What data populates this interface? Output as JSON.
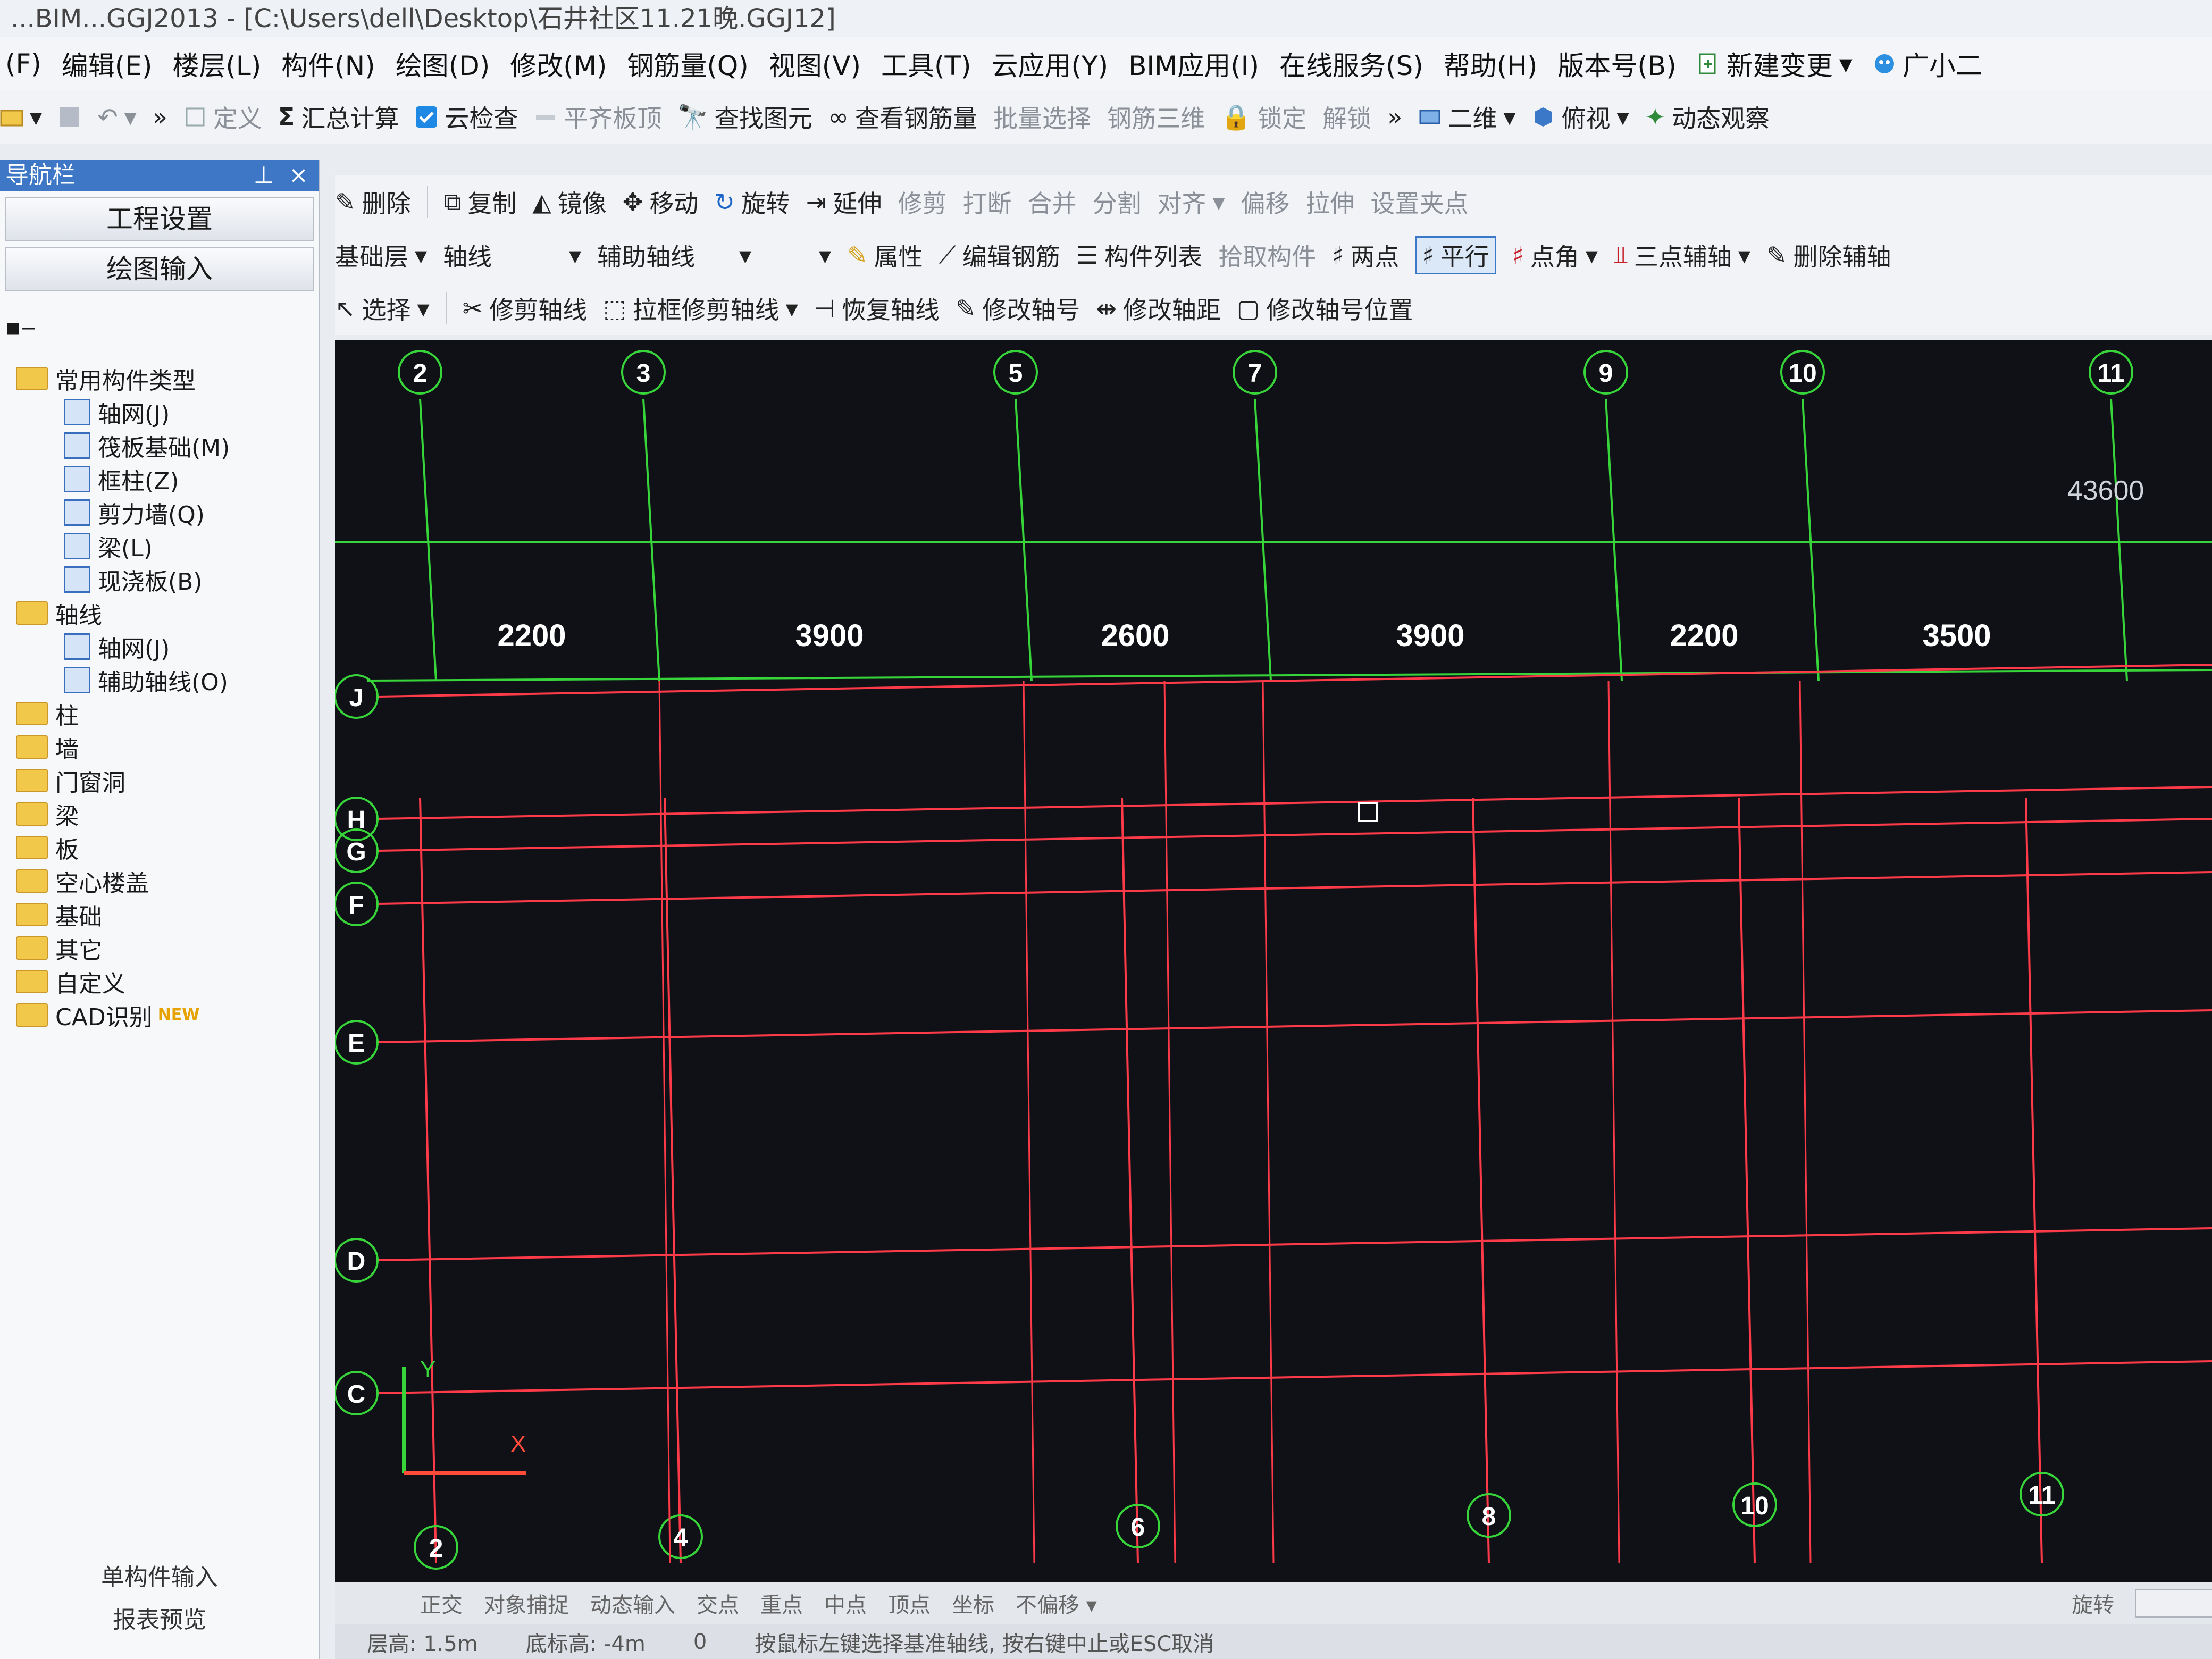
{
  "window": {
    "title": "...BIM...GGJ2013 - [C:\\Users\\dell\\Desktop\\石井社区11.21晚.GGJ12]"
  },
  "menu": [
    "(F)",
    "编辑(E)",
    "楼层(L)",
    "构件(N)",
    "绘图(D)",
    "修改(M)",
    "钢筋量(Q)",
    "视图(V)",
    "工具(T)",
    "云应用(Y)",
    "BIM应用(I)",
    "在线服务(S)",
    "帮助(H)",
    "版本号(B)"
  ],
  "menu_extra": {
    "new_change": "新建变更",
    "assistant": "广小二"
  },
  "toolbar1": {
    "define": "定义",
    "sum_calc": "汇总计算",
    "cloud_check": "云检查",
    "flat_slab_top": "平齐板顶",
    "find_element": "查找图元",
    "view_rebar": "查看钢筋量",
    "batch_select": "批量选择",
    "rebar_3d": "钢筋三维",
    "lock": "锁定",
    "unlock": "解锁",
    "view_2d": "二维",
    "top_view": "俯视",
    "dynamic_view": "动态观察"
  },
  "toolbar2": {
    "delete": "删除",
    "copy": "复制",
    "mirror": "镜像",
    "move": "移动",
    "rotate": "旋转",
    "extend": "延伸",
    "trim": "修剪",
    "break": "打断",
    "merge": "合并",
    "split": "分割",
    "align": "对齐",
    "offset": "偏移",
    "stretch": "拉伸",
    "set_grip": "设置夹点"
  },
  "toolbar3": {
    "floor": "基础层",
    "category": "轴线",
    "subtype": "辅助轴线",
    "property": "属性",
    "edit_rebar": "编辑钢筋",
    "element_list": "构件列表",
    "pick_element": "拾取构件",
    "two_point": "两点",
    "parallel": "平行",
    "point_angle": "点角",
    "three_point_aux": "三点辅轴",
    "delete_aux": "删除辅轴"
  },
  "toolbar4": {
    "select": "选择",
    "trim_axis": "修剪轴线",
    "box_trim_axis": "拉框修剪轴线",
    "restore_axis": "恢复轴线",
    "edit_axis_no": "修改轴号",
    "edit_axis_dist": "修改轴距",
    "edit_axis_pos": "修改轴号位置"
  },
  "nav": {
    "title": "导航栏",
    "project_settings": "工程设置",
    "drawing_input": "绘图输入",
    "tree": [
      {
        "label": "常用构件类型",
        "type": "folder",
        "indent": 0
      },
      {
        "label": "轴网(J)",
        "type": "item",
        "indent": 1
      },
      {
        "label": "筏板基础(M)",
        "type": "item",
        "indent": 1
      },
      {
        "label": "框柱(Z)",
        "type": "item",
        "indent": 1
      },
      {
        "label": "剪力墙(Q)",
        "type": "item",
        "indent": 1
      },
      {
        "label": "梁(L)",
        "type": "item",
        "indent": 1
      },
      {
        "label": "现浇板(B)",
        "type": "item",
        "indent": 1
      },
      {
        "label": "轴线",
        "type": "folder",
        "indent": 0
      },
      {
        "label": "轴网(J)",
        "type": "item",
        "indent": 1
      },
      {
        "label": "辅助轴线(O)",
        "type": "item",
        "indent": 1
      },
      {
        "label": "柱",
        "type": "folder",
        "indent": 0
      },
      {
        "label": "墙",
        "type": "folder",
        "indent": 0
      },
      {
        "label": "门窗洞",
        "type": "folder",
        "indent": 0
      },
      {
        "label": "梁",
        "type": "folder",
        "indent": 0
      },
      {
        "label": "板",
        "type": "folder",
        "indent": 0
      },
      {
        "label": "空心楼盖",
        "type": "folder",
        "indent": 0
      },
      {
        "label": "基础",
        "type": "folder",
        "indent": 0
      },
      {
        "label": "其它",
        "type": "folder",
        "indent": 0
      },
      {
        "label": "自定义",
        "type": "folder",
        "indent": 0
      },
      {
        "label": "CAD识别",
        "type": "folder",
        "indent": 0
      }
    ],
    "new_badge": "NEW",
    "single_input": "单构件输入",
    "report_preview": "报表预览"
  },
  "grid": {
    "top_axes": [
      "2",
      "3",
      "5",
      "7",
      "9",
      "10",
      "11"
    ],
    "bottom_axes": [
      "2",
      "4",
      "6",
      "8",
      "10",
      "11"
    ],
    "left_axes": [
      "J",
      "H",
      "G",
      "F",
      "E",
      "D",
      "C"
    ],
    "spacings": [
      "2200",
      "3900",
      "2600",
      "3900",
      "2200",
      "3500"
    ],
    "total": "43600",
    "colors": {
      "background": "#0f1116",
      "main_axis": "#37d43a",
      "aux_axis": "#ff3b4a",
      "label": "#ffffff"
    }
  },
  "status": {
    "ortho": "正交",
    "snap": "对象捕捉",
    "dynamic_input": "动态输入",
    "intersection": "交点",
    "midpoint_mark": "重点",
    "midpoint": "中点",
    "vertex": "顶点",
    "coordinate": "坐标",
    "no_offset": "不偏移",
    "rotate": "旋转"
  },
  "bottom": {
    "floor_height": "层高: 1.5m",
    "bottom_elev": "底标高: -4m",
    "zero": "0",
    "hint": "按鼠标左键选择基准轴线, 按右键中止或ESC取消"
  }
}
